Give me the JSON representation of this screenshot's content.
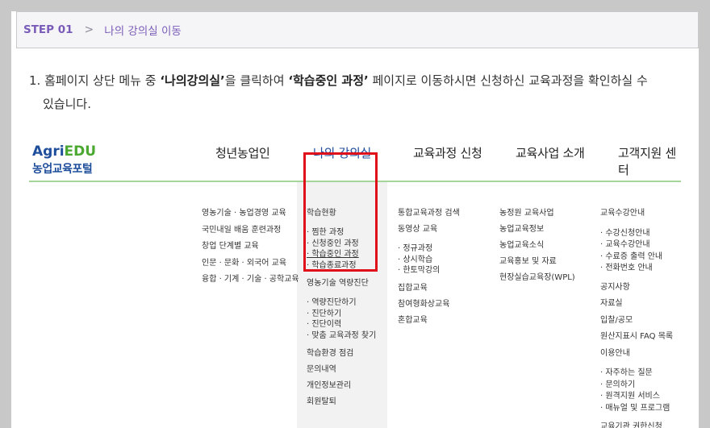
{
  "step": {
    "number": "STEP 01",
    "chevron": ">",
    "title": "나의 강의실 이동"
  },
  "instruction": {
    "prefix": "1. 홈페이지 상단 메뉴 중 ",
    "menu_name": "‘나의강의실’",
    "middle": "을 클릭하여 ",
    "page_name": "‘학습중인 과정’",
    "suffix": " 페이지로 이동하시면 신청하신 교육과정을 확인하실 수",
    "line2": "있습니다."
  },
  "logo": {
    "agri": "Agri",
    "edu": "EDU",
    "subtitle": "농업교육포털"
  },
  "nav": [
    {
      "label": "청년농업인"
    },
    {
      "label": "나의 강의실"
    },
    {
      "label": "교육과정 신청"
    },
    {
      "label": "교육사업 소개"
    },
    {
      "label": "고객지원 센터"
    }
  ],
  "menus": {
    "youth": [
      "영농기술 · 농업경영 교육",
      "국민내일 배움 훈련과정",
      "창업 단계별 교육",
      "인문 · 문화 · 외국어 교육",
      "융합 · 기계 · 기술 · 공학교육"
    ],
    "classroom": [
      {
        "text": "학습현황",
        "sub": false
      },
      {
        "text": "· 찜한 과정",
        "sub": true
      },
      {
        "text": "· 신청중인 과정",
        "sub": true
      },
      {
        "text": "· 학습중인 과정",
        "sub": true,
        "underline": true
      },
      {
        "text": "· 학습종료과정",
        "sub": true
      },
      {
        "text": "영농기술 역량진단",
        "sub": false
      },
      {
        "text": "· 역량진단하기",
        "sub": true
      },
      {
        "text": "· 진단하기",
        "sub": true
      },
      {
        "text": "· 진단이력",
        "sub": true
      },
      {
        "text": "· 맞춤 교육과정 찾기",
        "sub": true
      },
      {
        "text": "학습환경 점검",
        "sub": false
      },
      {
        "text": "문의내역",
        "sub": false
      },
      {
        "text": "개인정보관리",
        "sub": false
      },
      {
        "text": "회원탈퇴",
        "sub": false
      }
    ],
    "courses": [
      {
        "text": "통합교육과정 검색",
        "sub": false
      },
      {
        "text": "동영상 교육",
        "sub": false
      },
      {
        "text": "· 정규과정",
        "sub": true
      },
      {
        "text": "· 상시학습",
        "sub": true
      },
      {
        "text": "· 한토막강의",
        "sub": true
      },
      {
        "text": "집합교육",
        "sub": false
      },
      {
        "text": "참여형화상교육",
        "sub": false
      },
      {
        "text": "혼합교육",
        "sub": false
      }
    ],
    "business": [
      "농정원 교육사업",
      "농업교육정보",
      "농업교육소식",
      "교육홍보 및 자료",
      "현장실습교육장(WPL)"
    ],
    "support": [
      {
        "text": "교육수강안내",
        "sub": false
      },
      {
        "text": "· 수강신청안내",
        "sub": true
      },
      {
        "text": "· 교육수강안내",
        "sub": true
      },
      {
        "text": "· 수료증 출력 안내",
        "sub": true
      },
      {
        "text": "· 전화번호 안내",
        "sub": true
      },
      {
        "text": "공지사항",
        "sub": false
      },
      {
        "text": "자료실",
        "sub": false
      },
      {
        "text": "입찰/공모",
        "sub": false
      },
      {
        "text": "원산지표시 FAQ 목록",
        "sub": false
      },
      {
        "text": "이용안내",
        "sub": false
      },
      {
        "text": "· 자주하는 질문",
        "sub": true
      },
      {
        "text": "· 문의하기",
        "sub": true
      },
      {
        "text": "· 원격지원 서비스",
        "sub": true
      },
      {
        "text": "· 매뉴얼 및 프로그램",
        "sub": true
      },
      {
        "text": "교육기관 권한신청",
        "sub": false
      }
    ]
  },
  "colors": {
    "step_accent": "#7a5cb8",
    "logo_blue": "#1f4e9c",
    "logo_green": "#4ba830",
    "nav_line": "#a6d59a",
    "highlight_box": "#e0101b"
  }
}
